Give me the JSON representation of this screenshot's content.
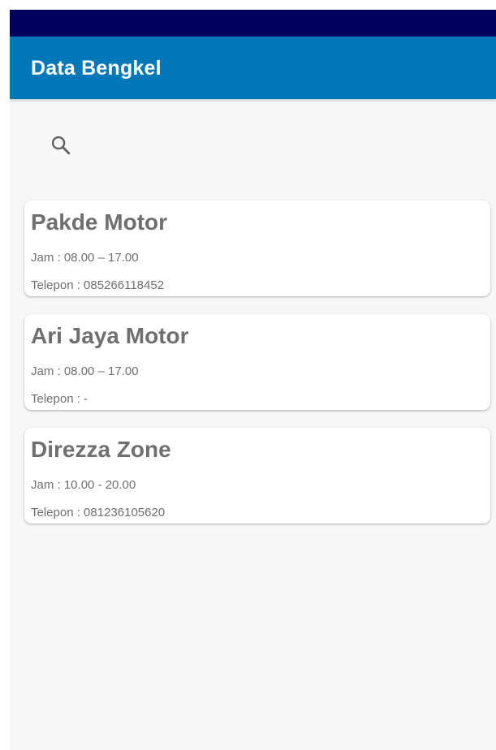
{
  "app_bar": {
    "title": "Data Bengkel"
  },
  "search": {
    "icon": "search-icon"
  },
  "workshops": [
    {
      "name": "Pakde Motor",
      "hours": "Jam : 08.00 – 17.00",
      "phone": "Telepon : 085266118452"
    },
    {
      "name": "Ari Jaya Motor",
      "hours": "Jam : 08.00 – 17.00",
      "phone": "Telepon : -"
    },
    {
      "name": "Direzza Zone",
      "hours": "Jam : 10.00 - 20.00",
      "phone": "Telepon : 081236105620"
    }
  ],
  "colors": {
    "status_bar": "#00005f",
    "app_bar": "#0378b9",
    "background": "#f7f7f7",
    "card_text": "#6f6f6f"
  }
}
